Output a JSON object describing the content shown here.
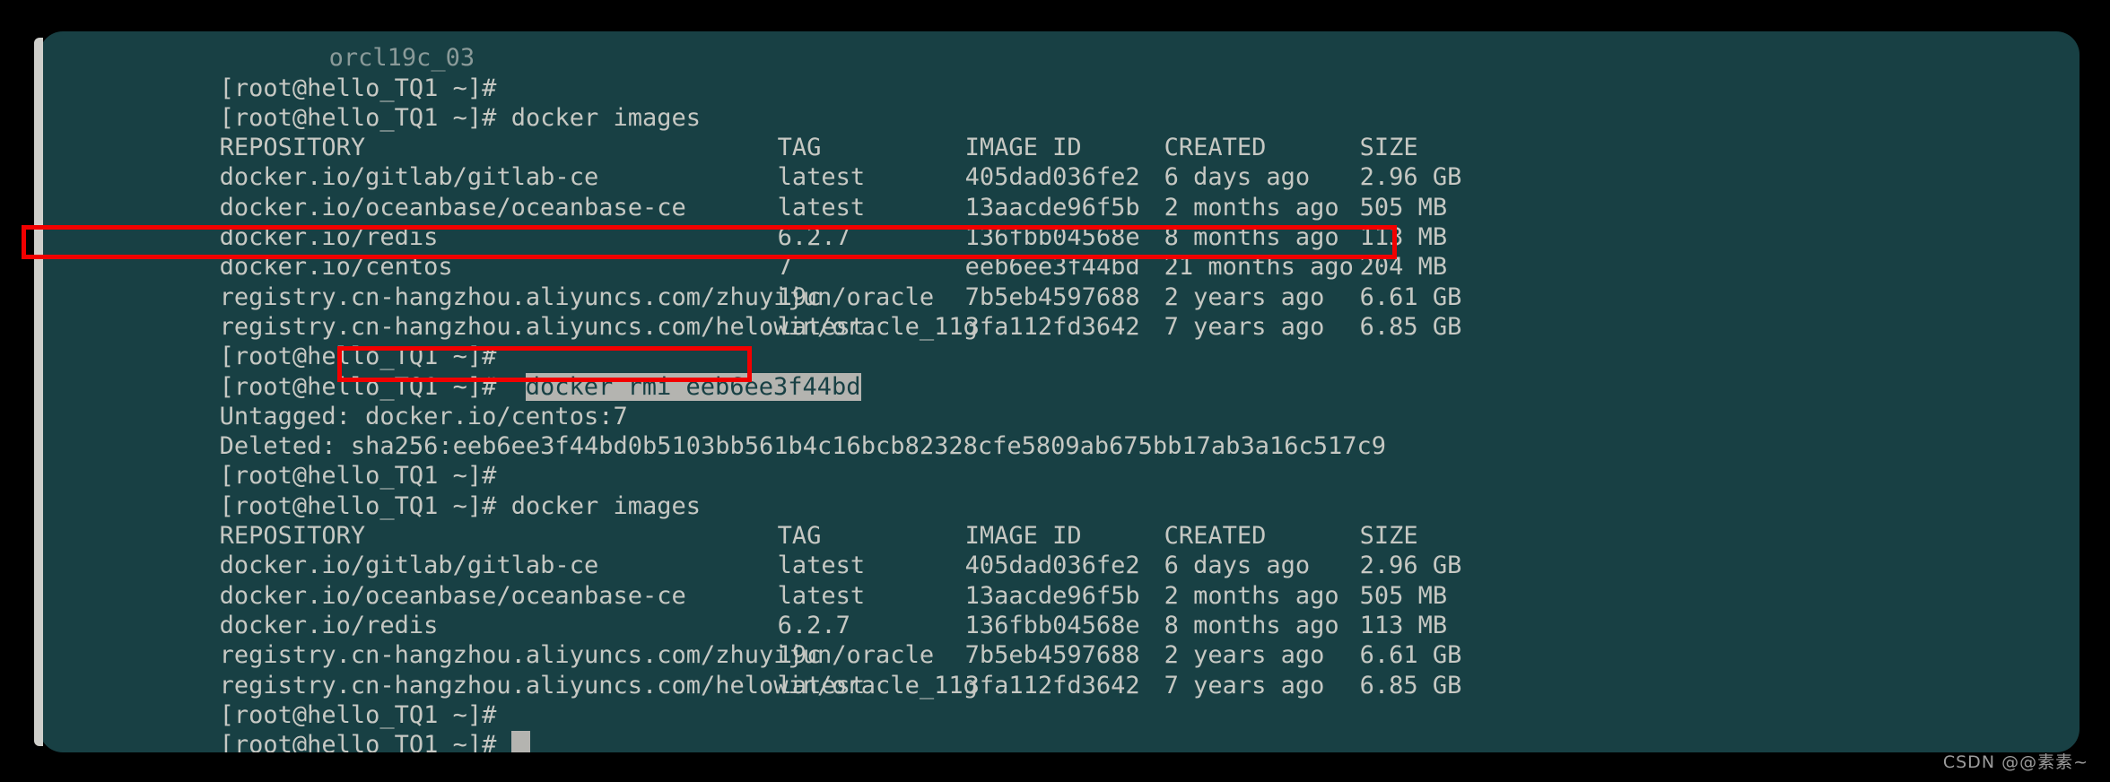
{
  "terminal": {
    "prompt": "[root@hello_TQ1 ~]#",
    "clipped_top_line": "orcl19c_03",
    "colors": {
      "background": "#184044",
      "text": "#c6c8c3",
      "page_background": "#000000",
      "annotation_red": "#f20000",
      "selection_background": "#b4b4b0",
      "selection_text": "#184044",
      "cursor": "#b4b4b0"
    },
    "commands": {
      "docker_images": "docker images",
      "docker_rmi": "docker rmi eeb6ee3f44bd"
    },
    "table_headers": {
      "repository": "REPOSITORY",
      "tag": "TAG",
      "image_id": "IMAGE ID",
      "created": "CREATED",
      "size": "SIZE"
    },
    "images_before": [
      {
        "repository": "docker.io/gitlab/gitlab-ce",
        "tag": "latest",
        "image_id": "405dad036fe2",
        "created": "6 days ago",
        "size": "2.96 GB"
      },
      {
        "repository": "docker.io/oceanbase/oceanbase-ce",
        "tag": "latest",
        "image_id": "13aacde96f5b",
        "created": "2 months ago",
        "size": "505 MB"
      },
      {
        "repository": "docker.io/redis",
        "tag": "6.2.7",
        "image_id": "136fbb04568e",
        "created": "8 months ago",
        "size": "113 MB"
      },
      {
        "repository": "docker.io/centos",
        "tag": "7",
        "image_id": "eeb6ee3f44bd",
        "created": "21 months ago",
        "size": "204 MB"
      },
      {
        "repository": "registry.cn-hangzhou.aliyuncs.com/zhuyijun/oracle",
        "tag": "19c",
        "image_id": "7b5eb4597688",
        "created": "2 years ago",
        "size": "6.61 GB"
      },
      {
        "repository": "registry.cn-hangzhou.aliyuncs.com/helowin/oracle_11g",
        "tag": "latest",
        "image_id": "3fa112fd3642",
        "created": "7 years ago",
        "size": "6.85 GB"
      }
    ],
    "images_after": [
      {
        "repository": "docker.io/gitlab/gitlab-ce",
        "tag": "latest",
        "image_id": "405dad036fe2",
        "created": "6 days ago",
        "size": "2.96 GB"
      },
      {
        "repository": "docker.io/oceanbase/oceanbase-ce",
        "tag": "latest",
        "image_id": "13aacde96f5b",
        "created": "2 months ago",
        "size": "505 MB"
      },
      {
        "repository": "docker.io/redis",
        "tag": "6.2.7",
        "image_id": "136fbb04568e",
        "created": "8 months ago",
        "size": "113 MB"
      },
      {
        "repository": "registry.cn-hangzhou.aliyuncs.com/zhuyijun/oracle",
        "tag": "19c",
        "image_id": "7b5eb4597688",
        "created": "2 years ago",
        "size": "6.61 GB"
      },
      {
        "repository": "registry.cn-hangzhou.aliyuncs.com/helowin/oracle_11g",
        "tag": "latest",
        "image_id": "3fa112fd3642",
        "created": "7 years ago",
        "size": "6.85 GB"
      }
    ],
    "rmi_output": {
      "untagged": "Untagged: docker.io/centos:7",
      "deleted": "Deleted: sha256:eeb6ee3f44bd0b5103bb561b4c16bcb82328cfe5809ab675bb17ab3a16c517c9"
    }
  },
  "watermark": "CSDN @@素素~"
}
